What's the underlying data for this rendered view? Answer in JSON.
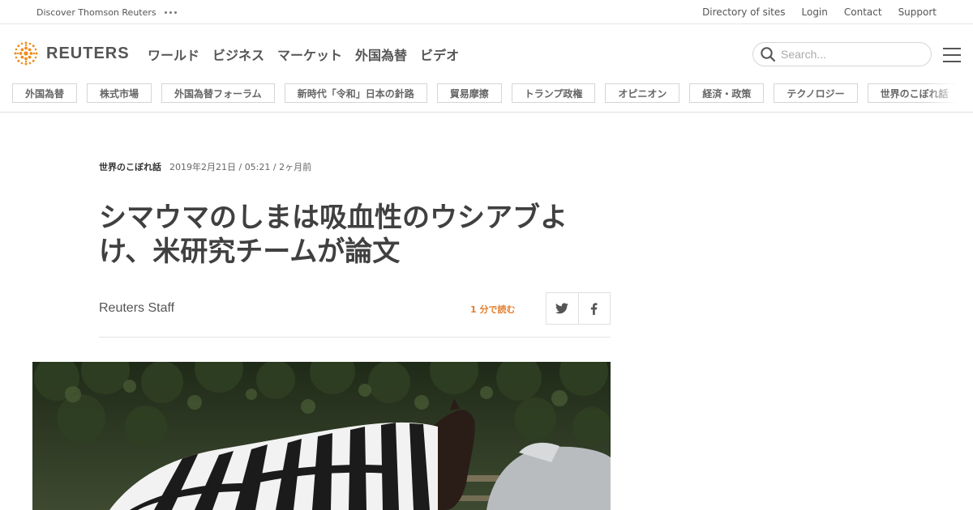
{
  "utility": {
    "discover_label": "Discover Thomson Reuters",
    "links": [
      "Directory of sites",
      "Login",
      "Contact",
      "Support"
    ]
  },
  "header": {
    "logo_text": "REUTERS",
    "nav": [
      "ワールド",
      "ビジネス",
      "マーケット",
      "外国為替",
      "ビデオ"
    ],
    "search_placeholder": "Search..."
  },
  "topics": [
    "外国為替",
    "株式市場",
    "外国為替フォーラム",
    "新時代「令和」日本の針路",
    "貿易摩擦",
    "トランプ政権",
    "オピニオン",
    "経済・政策",
    "テクノロジー",
    "世界のこぼれ話"
  ],
  "article": {
    "section": "世界のこぼれ話",
    "timestamp": "2019年2月21日 / 05:21 / 2ヶ月前",
    "headline": "シマウマのしまは吸血性のウシアブよけ、米研究チームが論文",
    "author": "Reuters Staff",
    "read_time": "1 分で読む"
  },
  "icons": {
    "logo": "reuters-dot-logo-icon",
    "search": "search-icon",
    "menu": "hamburger-menu-icon",
    "twitter": "twitter-icon",
    "facebook": "facebook-icon",
    "more": "ellipsis-icon"
  },
  "colors": {
    "brand_orange": "#e37d2c",
    "text": "#404040"
  }
}
